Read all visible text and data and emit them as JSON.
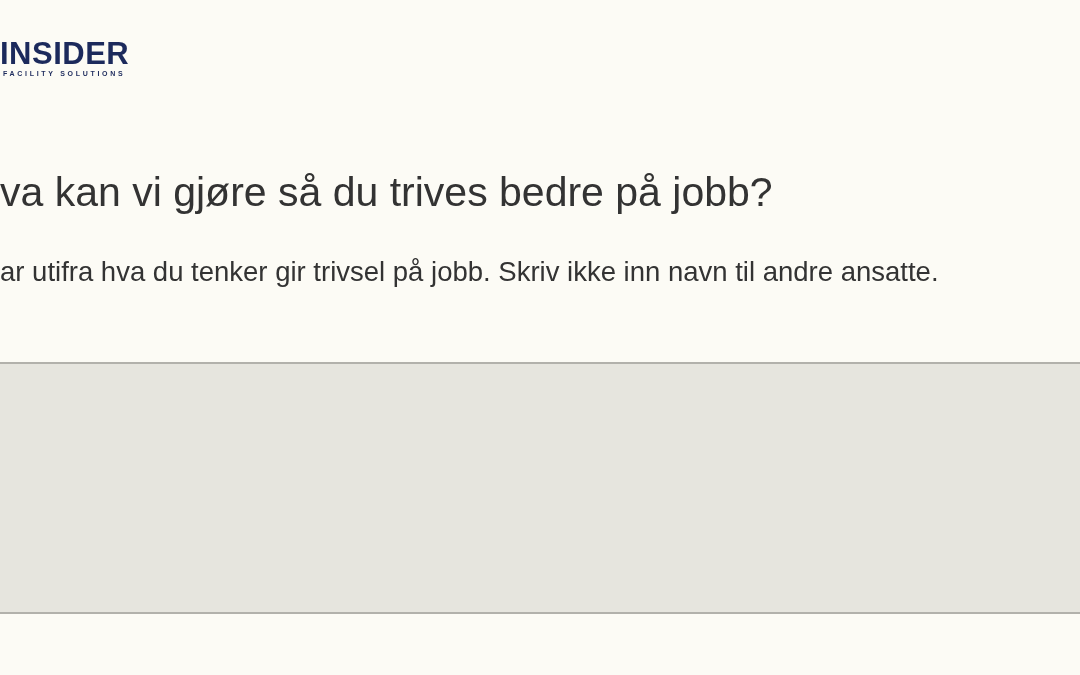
{
  "logo": {
    "name": "INSIDER",
    "tagline": "FACILITY SOLUTIONS"
  },
  "question": {
    "title": "va kan vi gjøre så du trives bedre på jobb?",
    "description": "ar utifra hva du tenker gir trivsel på jobb. Skriv ikke inn navn til andre ansatte."
  }
}
